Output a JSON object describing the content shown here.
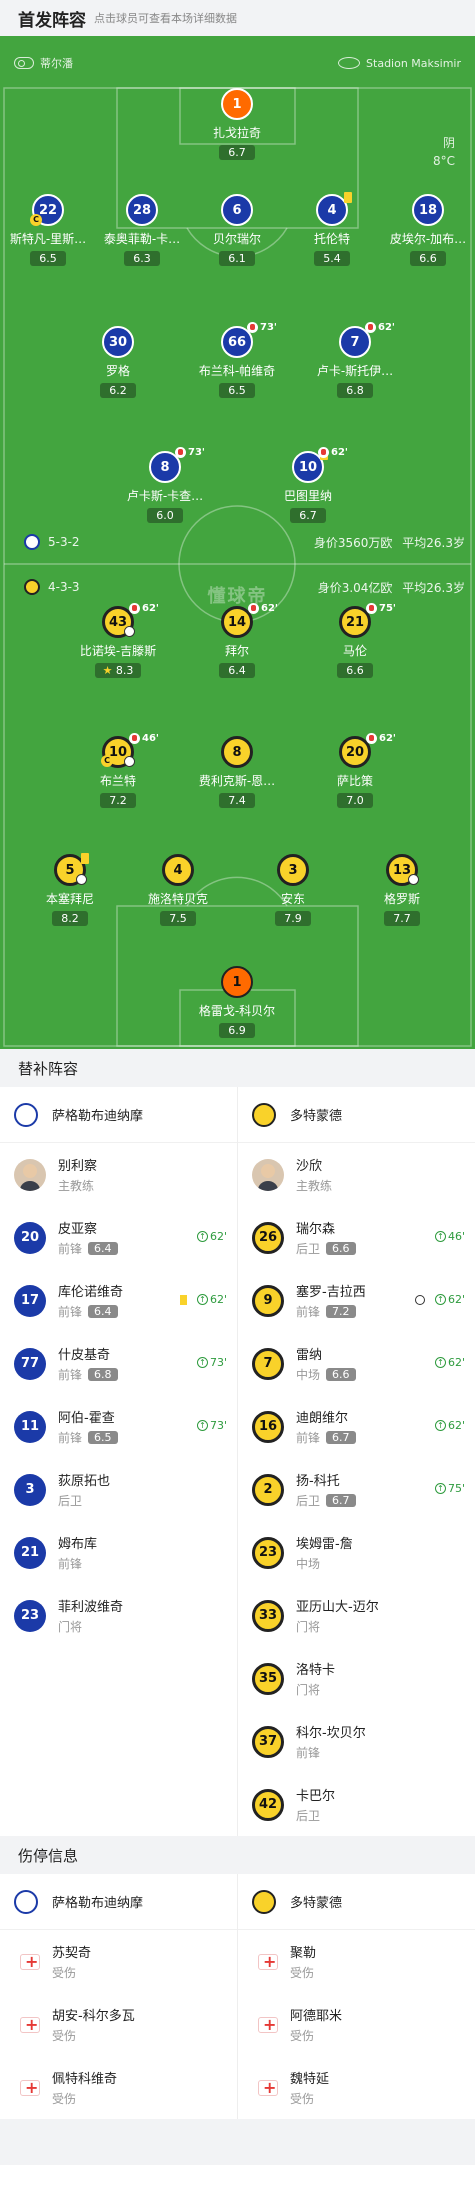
{
  "header": {
    "title": "首发阵容",
    "hint": "点击球员可查看本场详细数据"
  },
  "pitch": {
    "referee": "蒂尔潘",
    "stadium": "Stadion Maksimir",
    "weather": "阴",
    "temperature": "8°C",
    "watermark": "懂球帝",
    "home": {
      "formation": "5-3-2",
      "value": "身价3560万欧",
      "age": "平均26.3岁"
    },
    "away": {
      "formation": "4-3-3",
      "value": "身价3.04亿欧",
      "age": "平均26.3岁"
    },
    "home_players": [
      {
        "num": "1",
        "name": "扎戈拉奇",
        "rating": "6.7",
        "gk": true
      },
      {
        "num": "22",
        "name": "斯特凡-里斯…",
        "rating": "6.5",
        "captain": true
      },
      {
        "num": "28",
        "name": "泰奥菲勒-卡…",
        "rating": "6.3"
      },
      {
        "num": "6",
        "name": "贝尔瑞尔",
        "rating": "6.1"
      },
      {
        "num": "4",
        "name": "托伦特",
        "rating": "5.4",
        "yellow": true
      },
      {
        "num": "18",
        "name": "皮埃尔-加布…",
        "rating": "6.6"
      },
      {
        "num": "30",
        "name": "罗格",
        "rating": "6.2"
      },
      {
        "num": "66",
        "name": "布兰科-帕维奇",
        "rating": "6.5",
        "sub": "73'"
      },
      {
        "num": "7",
        "name": "卢卡-斯托伊…",
        "rating": "6.8",
        "sub": "62'"
      },
      {
        "num": "8",
        "name": "卢卡斯-卡查…",
        "rating": "6.0",
        "sub": "73'"
      },
      {
        "num": "10",
        "name": "巴图里纳",
        "rating": "6.7",
        "sub": "62'",
        "yellow": true
      }
    ],
    "away_players": [
      {
        "num": "43",
        "name": "比诺埃-吉滕斯",
        "rating": "8.3",
        "sub": "62'",
        "star": true,
        "ball": true
      },
      {
        "num": "14",
        "name": "拜尔",
        "rating": "6.4",
        "sub": "62'"
      },
      {
        "num": "21",
        "name": "马伦",
        "rating": "6.6",
        "sub": "75'"
      },
      {
        "num": "10",
        "name": "布兰特",
        "rating": "7.2",
        "sub": "46'",
        "captain": true,
        "ball": true
      },
      {
        "num": "8",
        "name": "费利克斯-恩…",
        "rating": "7.4"
      },
      {
        "num": "20",
        "name": "萨比策",
        "rating": "7.0",
        "sub": "62'"
      },
      {
        "num": "5",
        "name": "本塞拜尼",
        "rating": "8.2",
        "yellow": true,
        "ball": true
      },
      {
        "num": "4",
        "name": "施洛特贝克",
        "rating": "7.5"
      },
      {
        "num": "3",
        "name": "安东",
        "rating": "7.9"
      },
      {
        "num": "13",
        "name": "格罗斯",
        "rating": "7.7",
        "ball": true
      },
      {
        "num": "1",
        "name": "格雷戈-科贝尔",
        "rating": "6.9",
        "gk": true
      }
    ]
  },
  "subs": {
    "title": "替补阵容",
    "home_team": "萨格勒布迪纳摩",
    "away_team": "多特蒙德",
    "home_coach": {
      "name": "别利察",
      "role": "主教练"
    },
    "away_coach": {
      "name": "沙欣",
      "role": "主教练"
    },
    "home": [
      {
        "num": "20",
        "name": "皮亚察",
        "pos": "前锋",
        "rating": "6.4",
        "in": "62'"
      },
      {
        "num": "17",
        "name": "库伦诺维奇",
        "pos": "前锋",
        "rating": "6.4",
        "in": "62'",
        "yellow": true
      },
      {
        "num": "77",
        "name": "什皮基奇",
        "pos": "前锋",
        "rating": "6.8",
        "in": "73'"
      },
      {
        "num": "11",
        "name": "阿伯-霍查",
        "pos": "前锋",
        "rating": "6.5",
        "in": "73'"
      },
      {
        "num": "3",
        "name": "荻原拓也",
        "pos": "后卫"
      },
      {
        "num": "21",
        "name": "姆布库",
        "pos": "前锋"
      },
      {
        "num": "23",
        "name": "菲利波维奇",
        "pos": "门将"
      }
    ],
    "away": [
      {
        "num": "26",
        "name": "瑞尔森",
        "pos": "后卫",
        "rating": "6.6",
        "in": "46'"
      },
      {
        "num": "9",
        "name": "塞罗-吉拉西",
        "pos": "前锋",
        "rating": "7.2",
        "in": "62'",
        "ball": true
      },
      {
        "num": "7",
        "name": "雷纳",
        "pos": "中场",
        "rating": "6.6",
        "in": "62'"
      },
      {
        "num": "16",
        "name": "迪朗维尔",
        "pos": "前锋",
        "rating": "6.7",
        "in": "62'"
      },
      {
        "num": "2",
        "name": "扬-科托",
        "pos": "后卫",
        "rating": "6.7",
        "in": "75'"
      },
      {
        "num": "23",
        "name": "埃姆雷-詹",
        "pos": "中场"
      },
      {
        "num": "33",
        "name": "亚历山大-迈尔",
        "pos": "门将"
      },
      {
        "num": "35",
        "name": "洛特卡",
        "pos": "门将"
      },
      {
        "num": "37",
        "name": "科尔-坎贝尔",
        "pos": "前锋"
      },
      {
        "num": "42",
        "name": "卡巴尔",
        "pos": "后卫"
      }
    ]
  },
  "injuries": {
    "title": "伤停信息",
    "home_team": "萨格勒布迪纳摩",
    "away_team": "多特蒙德",
    "home": [
      {
        "name": "苏契奇",
        "status": "受伤"
      },
      {
        "name": "胡安-科尔多瓦",
        "status": "受伤"
      },
      {
        "name": "佩特科维奇",
        "status": "受伤"
      }
    ],
    "away": [
      {
        "name": "聚勒",
        "status": "受伤"
      },
      {
        "name": "阿德耶米",
        "status": "受伤"
      },
      {
        "name": "魏特延",
        "status": "受伤"
      }
    ]
  }
}
